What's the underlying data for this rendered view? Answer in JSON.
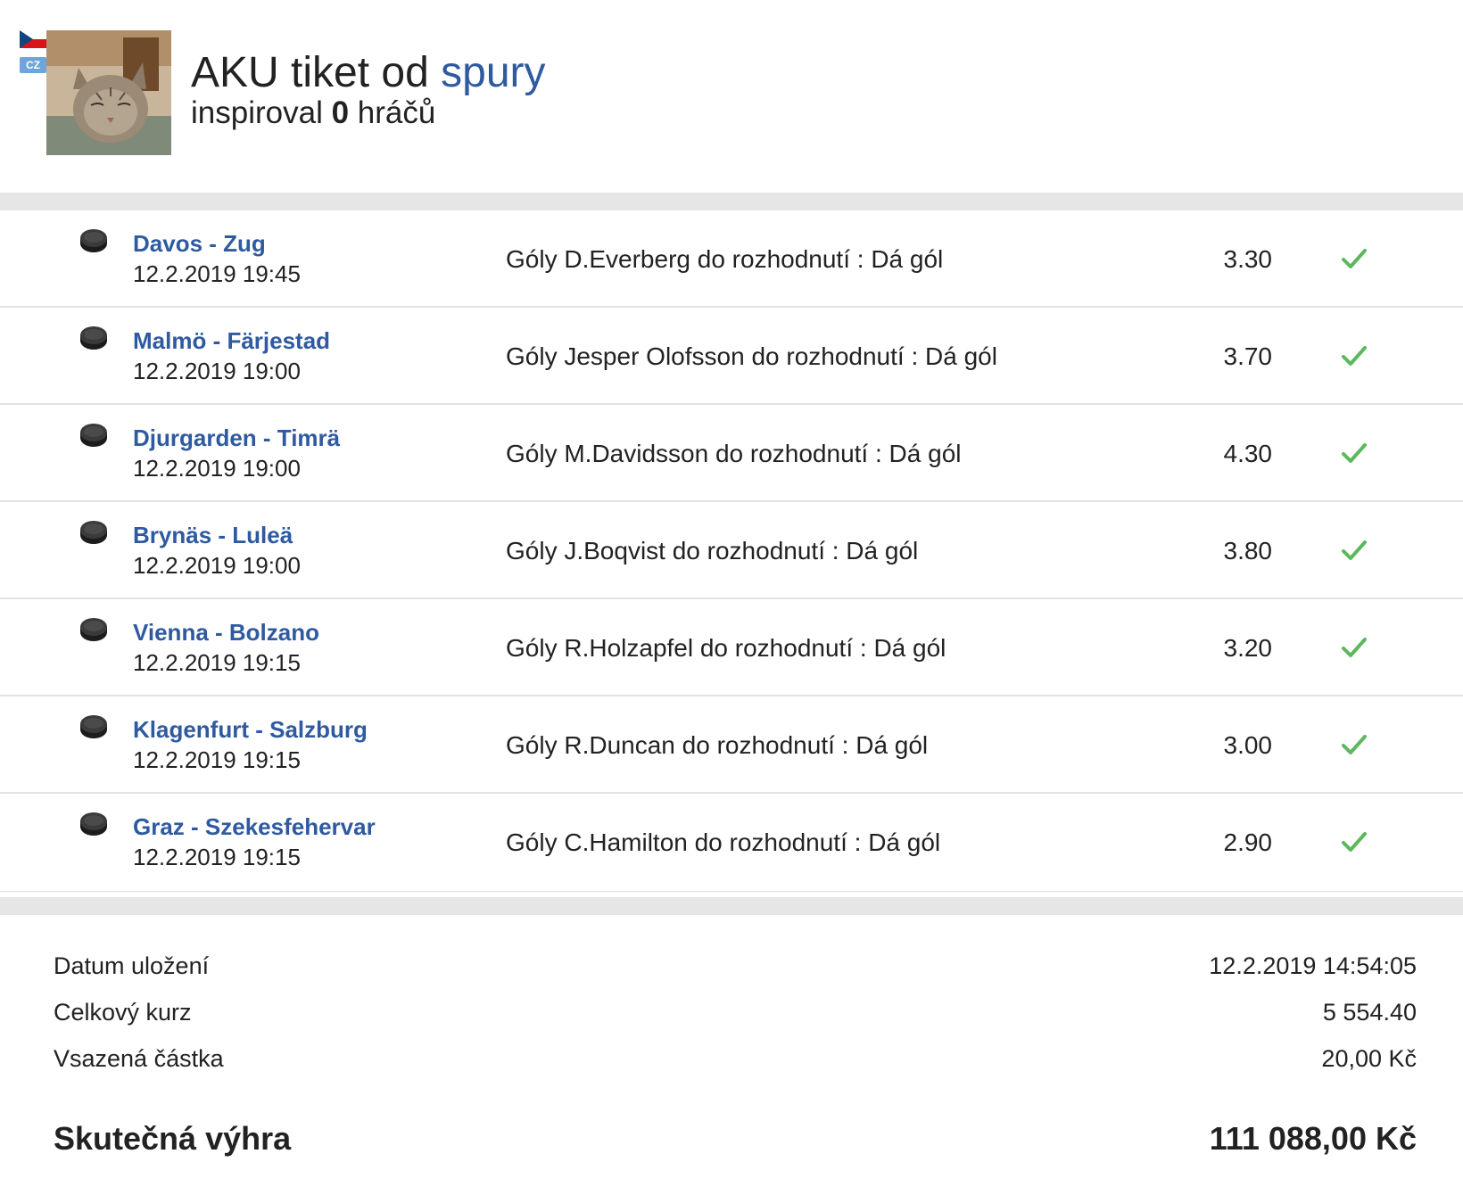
{
  "header": {
    "title_prefix": "AKU tiket od ",
    "username": "spury",
    "inspired_prefix": "inspiroval ",
    "inspired_count": "0",
    "inspired_suffix": " hráčů",
    "country_code": "CZ"
  },
  "bets": [
    {
      "match": "Davos - Zug",
      "datetime": "12.2.2019 19:45",
      "selection": "Góly D.Everberg do rozhodnutí : Dá gól",
      "odds": "3.30",
      "status": "won",
      "icon": "hockey-puck-icon"
    },
    {
      "match": "Malmö - Färjestad",
      "datetime": "12.2.2019 19:00",
      "selection": "Góly Jesper Olofsson do rozhodnutí : Dá gól",
      "odds": "3.70",
      "status": "won",
      "icon": "hockey-puck-icon"
    },
    {
      "match": "Djurgarden - Timrä",
      "datetime": "12.2.2019 19:00",
      "selection": "Góly M.Davidsson do rozhodnutí : Dá gól",
      "odds": "4.30",
      "status": "won",
      "icon": "hockey-puck-icon"
    },
    {
      "match": "Brynäs - Luleä",
      "datetime": "12.2.2019 19:00",
      "selection": "Góly J.Boqvist do rozhodnutí : Dá gól",
      "odds": "3.80",
      "status": "won",
      "icon": "hockey-puck-icon"
    },
    {
      "match": "Vienna - Bolzano",
      "datetime": "12.2.2019 19:15",
      "selection": "Góly R.Holzapfel do rozhodnutí : Dá gól",
      "odds": "3.20",
      "status": "won",
      "icon": "hockey-puck-icon"
    },
    {
      "match": "Klagenfurt - Salzburg",
      "datetime": "12.2.2019 19:15",
      "selection": "Góly R.Duncan do rozhodnutí : Dá gól",
      "odds": "3.00",
      "status": "won",
      "icon": "hockey-puck-icon"
    },
    {
      "match": "Graz - Szekesfehervar",
      "datetime": "12.2.2019 19:15",
      "selection": "Góly C.Hamilton do rozhodnutí : Dá gól",
      "odds": "2.90",
      "status": "won",
      "icon": "hockey-puck-icon"
    }
  ],
  "summary": {
    "date_label": "Datum uložení",
    "date_value": "12.2.2019 14:54:05",
    "total_odds_label": "Celkový kurz",
    "total_odds_value": "5 554.40",
    "stake_label": "Vsazená částka",
    "stake_value": "20,00 Kč",
    "win_label": "Skutečná výhra",
    "win_value": "111 088,00 Kč"
  },
  "colors": {
    "link": "#2f5aa0",
    "check": "#5cb85c",
    "separator": "#e6e6e6"
  }
}
